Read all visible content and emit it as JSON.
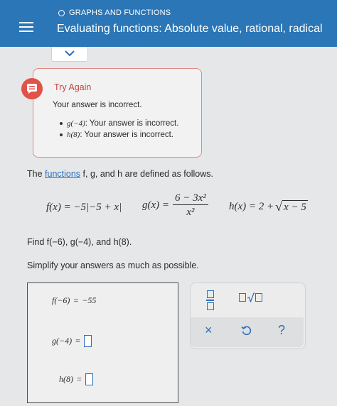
{
  "header": {
    "subject": "GRAPHS AND FUNCTIONS",
    "topic": "Evaluating functions: Absolute value, rational, radical"
  },
  "feedback": {
    "title": "Try Again",
    "message": "Your answer is incorrect.",
    "items": [
      {
        "fn": "g(−4)",
        "text": ": Your answer is incorrect."
      },
      {
        "fn": "h(8)",
        "text": ": Your answer is incorrect."
      }
    ]
  },
  "problem": {
    "intro_before": "The ",
    "intro_link": "functions",
    "intro_after": " f, g, and h are defined as follows.",
    "f_def": "f(x) = −5|−5 + x|",
    "g_lhs": "g(x) =",
    "g_num": "6 − 3x²",
    "g_den": "x²",
    "h_lhs": "h(x) = 2 +",
    "h_radicand": "x − 5",
    "find": "Find f(−6), g(−4), and h(8).",
    "simplify": "Simplify your answers as much as possible."
  },
  "answers": [
    {
      "label": "f(−6)",
      "eq": "=",
      "value": "−55"
    },
    {
      "label": "g(−4)",
      "eq": "=",
      "value": ""
    },
    {
      "label": "h(8)",
      "eq": "=",
      "value": ""
    }
  ],
  "toolbar": {
    "clear_symbol": "×",
    "help_symbol": "?",
    "icons": [
      "fraction-icon",
      "square-root-icon",
      "clear-icon",
      "undo-icon",
      "help-icon"
    ]
  },
  "colors": {
    "header": "#2a76b6",
    "accent": "#2a6ebd",
    "error": "#e15248",
    "feedback_border": "#e08a84"
  }
}
